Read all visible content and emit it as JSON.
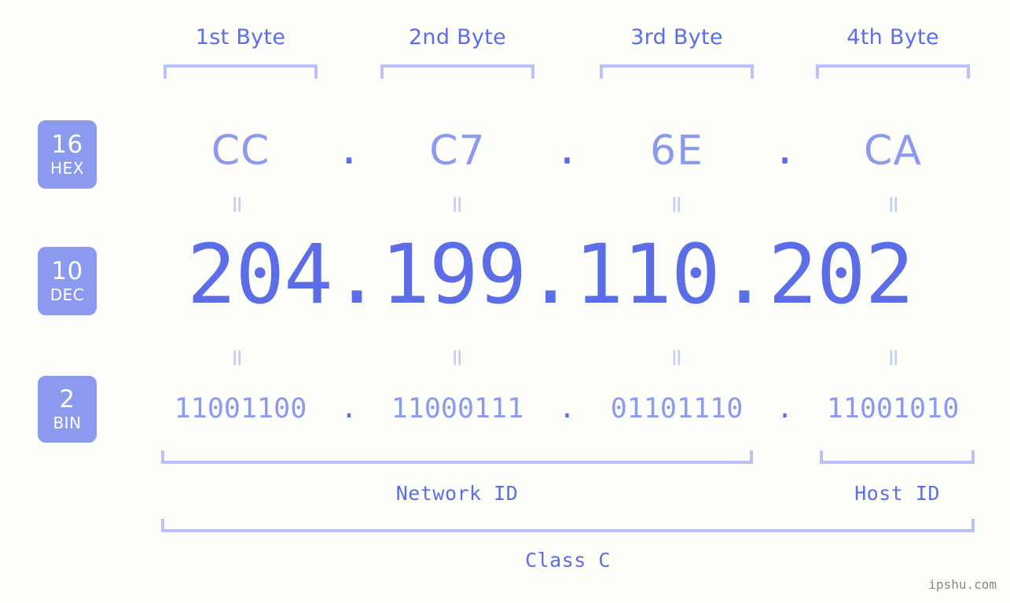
{
  "background_color": "#fdfdfa",
  "accent_strong": "#5b6ee8",
  "accent_mid": "#8b9aef",
  "accent_light": "#b9c2f8",
  "headers": {
    "bytes": [
      {
        "label": "1st Byte"
      },
      {
        "label": "2nd Byte"
      },
      {
        "label": "3rd Byte"
      },
      {
        "label": "4th Byte"
      }
    ]
  },
  "radix": {
    "hex": {
      "number": "16",
      "unit": "HEX"
    },
    "dec": {
      "number": "10",
      "unit": "DEC"
    },
    "bin": {
      "number": "2",
      "unit": "BIN"
    }
  },
  "rows": {
    "hex": {
      "octets": [
        "CC",
        "C7",
        "6E",
        "CA"
      ],
      "separator": "."
    },
    "dec": {
      "octets": [
        "204",
        "199",
        "110",
        "202"
      ],
      "separator": ".",
      "full": "204.199.110.202"
    },
    "bin": {
      "octets": [
        "11001100",
        "11000111",
        "01101110",
        "11001010"
      ],
      "separator": "."
    }
  },
  "connectors": {
    "equals": "="
  },
  "footer": {
    "network_id": "Network ID",
    "host_id": "Host ID",
    "class": "Class C"
  },
  "watermark": "ipshu.com"
}
